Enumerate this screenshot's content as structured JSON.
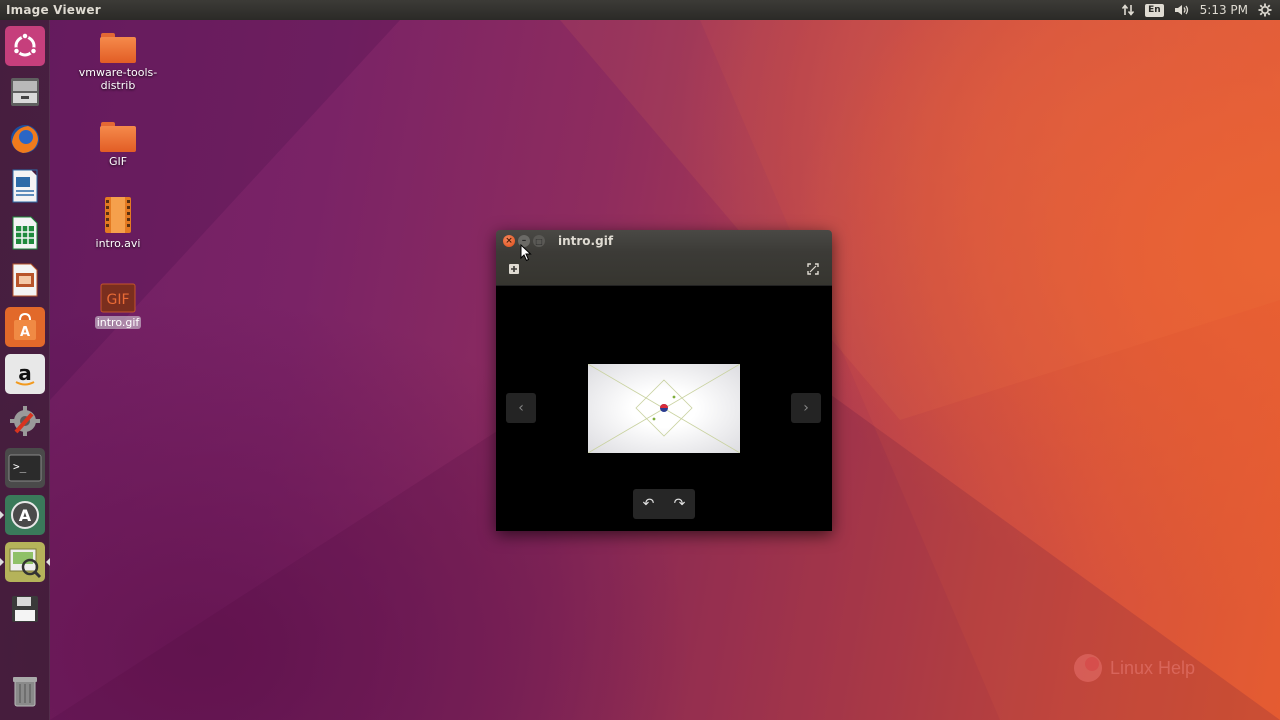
{
  "panel": {
    "app_title": "Image Viewer",
    "language": "En",
    "time": "5:13 PM",
    "icons": [
      "network-icon",
      "keyboard-language-icon",
      "volume-icon",
      "settings-gear-icon"
    ]
  },
  "launcher": {
    "items": [
      {
        "name": "ubuntu-dash",
        "icon": "ubuntu-logo-icon"
      },
      {
        "name": "files",
        "icon": "file-cabinet-icon"
      },
      {
        "name": "firefox",
        "icon": "firefox-icon"
      },
      {
        "name": "libreoffice-writer",
        "icon": "writer-document-icon"
      },
      {
        "name": "libreoffice-calc",
        "icon": "calc-spreadsheet-icon"
      },
      {
        "name": "libreoffice-impress",
        "icon": "impress-presentation-icon"
      },
      {
        "name": "software-center",
        "icon": "shopping-bag-icon"
      },
      {
        "name": "amazon",
        "icon": "amazon-logo-icon"
      },
      {
        "name": "system-settings",
        "icon": "settings-tools-icon"
      },
      {
        "name": "terminal",
        "icon": "terminal-icon"
      },
      {
        "name": "software-updater",
        "icon": "updater-icon"
      },
      {
        "name": "image-viewer",
        "icon": "image-viewer-icon"
      },
      {
        "name": "save-device",
        "icon": "floppy-disk-icon"
      },
      {
        "name": "trash",
        "icon": "trash-icon"
      }
    ]
  },
  "desktop": {
    "icons": [
      {
        "label": "vmware-tools-distrib",
        "type": "folder"
      },
      {
        "label": "GIF",
        "type": "folder"
      },
      {
        "label": "intro.avi",
        "type": "video"
      },
      {
        "label": "intro.gif",
        "type": "gif",
        "selected": true
      }
    ],
    "label_line1": "vmware-tools-",
    "label_line2": "distrib"
  },
  "viewer": {
    "title": "intro.gif",
    "controls": {
      "close": "×",
      "minimize": "–",
      "maximize": "□",
      "prev": "‹",
      "next": "›",
      "rotate_left": "↶",
      "rotate_right": "↷"
    }
  },
  "watermark": {
    "text": "Linux Help"
  },
  "colors": {
    "accent_orange": "#e95420",
    "panel_dark": "#3c3b37"
  }
}
